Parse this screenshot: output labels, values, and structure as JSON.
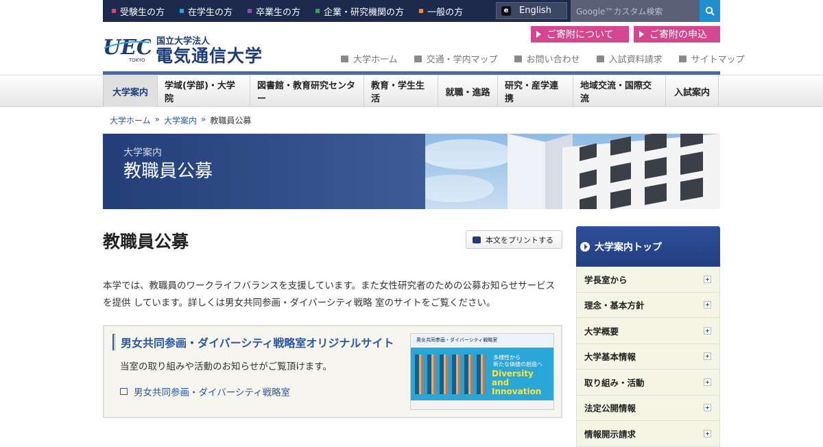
{
  "topbar": {
    "audiences": [
      {
        "label": "受験生の方",
        "color": "#e0426c"
      },
      {
        "label": "在学生の方",
        "color": "#2aa2de"
      },
      {
        "label": "卒業生の方",
        "color": "#8e4fb7"
      },
      {
        "label": "企業・研究機関の方",
        "color": "#3aa64c"
      },
      {
        "label": "一般の方",
        "color": "#f0862d"
      }
    ],
    "english": "English",
    "search_placeholder": "Google™カスタム検索"
  },
  "header": {
    "logo_text": "UEC",
    "logo_sub": "TOKYO",
    "org_kind": "国立大学法人",
    "org_name": "電気通信大学",
    "donate": [
      "ご寄附について",
      "ご寄附の申込"
    ],
    "utility": [
      "大学ホーム",
      "交通・学内マップ",
      "お問い合わせ",
      "入試資料請求",
      "サイトマップ"
    ]
  },
  "gnav": [
    "大学案内",
    "学域(学部)・大学院",
    "図書館・教育研究センター",
    "教育・学生生活",
    "就職・進路",
    "研究・産学連携",
    "地域交流・国際交流",
    "入試案内"
  ],
  "breadcrumb": [
    "大学ホーム",
    "大学案内",
    "教職員公募"
  ],
  "hero": {
    "sub": "大学案内",
    "title": "教職員公募"
  },
  "main": {
    "title": "教職員公募",
    "print_label": "本文をプリントする",
    "intro": "本学では、教職員のワークライフバランスを支援しています。また女性研究者のための公募お知らせサービスを提供 しています。詳しくは男女共同参画・ダイバーシティ戦略 室のサイトをご覧ください。",
    "box": {
      "title": "男女共同参画・ダイバーシティ戦略室オリジナルサイト",
      "desc": "当室の取り組みや活動のお知らせがご覧頂けます。",
      "link": "男女共同参画・ダイバーシティ戦略室",
      "thumb_head": "男女共同参画・ダイバーシティ戦略室",
      "thumb_lead": "多様性から\n新たな価値の創造へ",
      "thumb_title": "Diversity\nand\nInnovation"
    }
  },
  "sidebar": {
    "top": "大学案内トップ",
    "items": [
      "学長室から",
      "理念・基本方針",
      "大学概要",
      "大学基本情報",
      "取り組み・活動",
      "法定公開情報",
      "情報開示請求"
    ]
  }
}
